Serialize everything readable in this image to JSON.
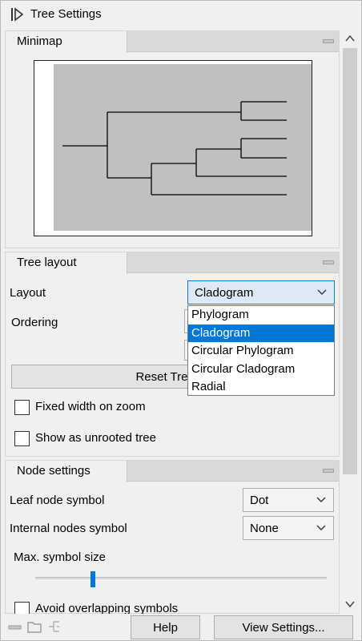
{
  "title": "Tree Settings",
  "minimap": {
    "tab_label": "Minimap"
  },
  "tree_layout": {
    "tab_label": "Tree layout",
    "layout_label": "Layout",
    "layout_value": "Cladogram",
    "layout_options": [
      "Phylogram",
      "Cladogram",
      "Circular Phylogram",
      "Circular Cladogram",
      "Radial"
    ],
    "layout_selected_index": 1,
    "ordering_label": "Ordering",
    "reset_button": "Reset Tree To",
    "fixed_width_label": "Fixed width on zoom",
    "fixed_width_checked": false,
    "unrooted_label": "Show as unrooted tree",
    "unrooted_checked": false
  },
  "node_settings": {
    "tab_label": "Node settings",
    "leaf_label": "Leaf node symbol",
    "leaf_value": "Dot",
    "internal_label": "Internal nodes symbol",
    "internal_value": "None",
    "max_size_label": "Max. symbol size",
    "max_size_level": 0.19,
    "avoid_overlap_label": "Avoid overlapping symbols",
    "avoid_overlap_checked": false
  },
  "footer": {
    "help_button": "Help",
    "view_settings_button": "View Settings..."
  },
  "colors": {
    "accent": "#0078d7",
    "selection": "#0078d7",
    "minimap_bg": "#c0c0c0"
  }
}
